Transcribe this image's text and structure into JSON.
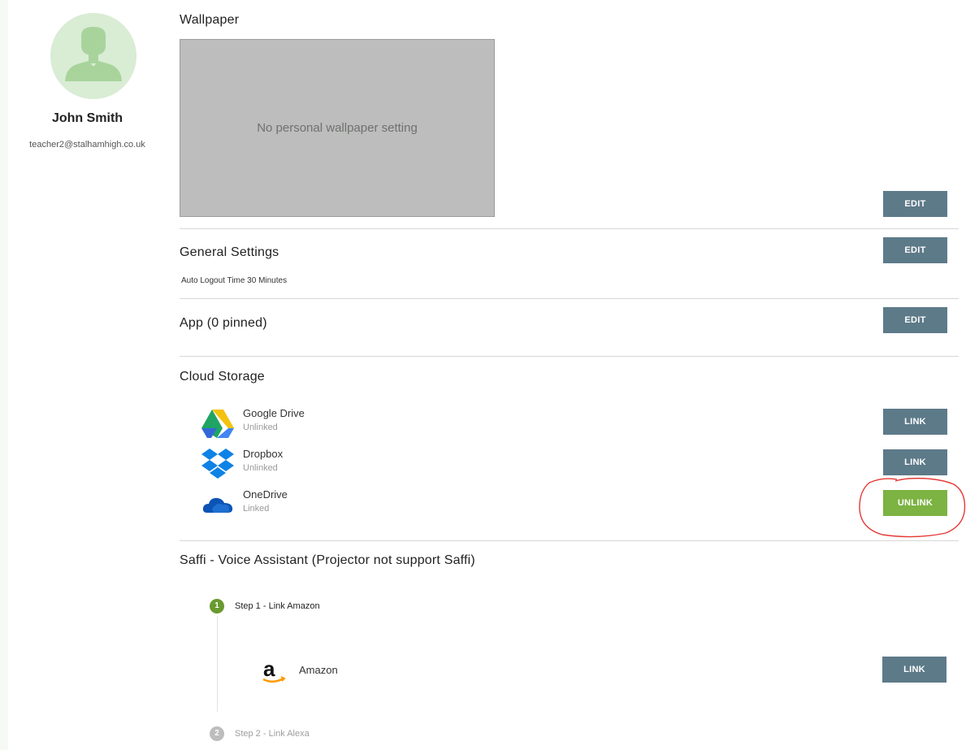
{
  "profile": {
    "name": "John Smith",
    "email": "teacher2@stalhamhigh.co.uk"
  },
  "wallpaper": {
    "title": "Wallpaper",
    "placeholder_text": "No personal wallpaper setting",
    "edit_label": "EDIT"
  },
  "general": {
    "title": "General Settings",
    "edit_label": "EDIT",
    "auto_logout": "Auto Logout Time 30 Minutes"
  },
  "app": {
    "title": "App (0 pinned)",
    "edit_label": "EDIT"
  },
  "cloud": {
    "title": "Cloud Storage",
    "services": [
      {
        "name": "Google Drive",
        "status": "Unlinked",
        "action": "LINK",
        "icon": "google-drive-icon"
      },
      {
        "name": "Dropbox",
        "status": "Unlinked",
        "action": "LINK",
        "icon": "dropbox-icon"
      },
      {
        "name": "OneDrive",
        "status": "Linked",
        "action": "UNLINK",
        "icon": "onedrive-icon"
      }
    ]
  },
  "saffi": {
    "title": "Saffi - Voice Assistant (Projector not support Saffi)",
    "steps": [
      {
        "number": "1",
        "label": "Step 1 - Link Amazon"
      },
      {
        "number": "2",
        "label": "Step 2 - Link Alexa"
      }
    ],
    "amazon": {
      "name": "Amazon",
      "action": "LINK",
      "icon": "amazon-icon"
    }
  },
  "colors": {
    "action_button": "#5d7a89",
    "unlink_button": "#7cb342",
    "active_step": "#6a9a2f",
    "inactive_step": "#bdbdbd",
    "annotation": "#e53935"
  }
}
